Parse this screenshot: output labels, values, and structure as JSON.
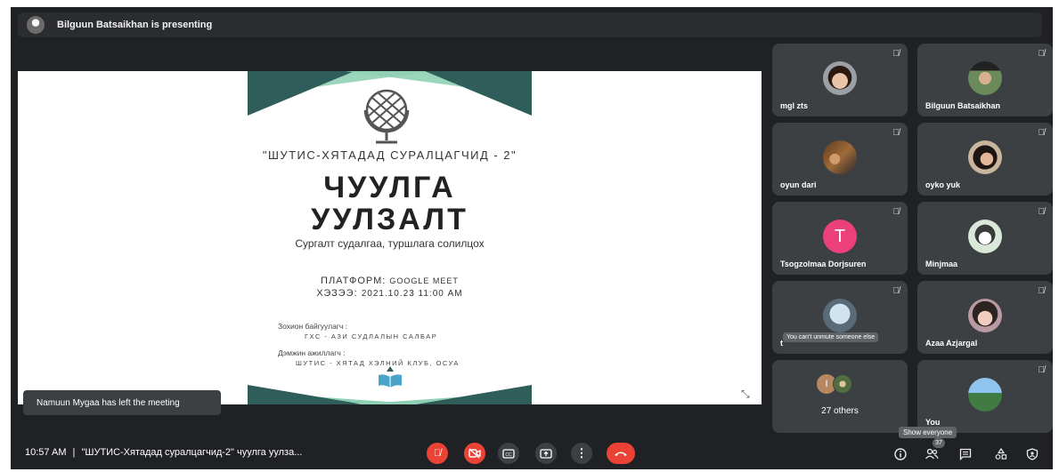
{
  "presenter": {
    "text": "Bilguun Batsaikhan is presenting"
  },
  "slide": {
    "subtitle_top": "\"ШУТИС-ХЯТАДАД СУРАЛЦАГЧИД - 2\"",
    "title_line1": "ЧУУЛГА",
    "title_line2": "УУЛЗАЛТ",
    "tagline": "Сургалт судалгаа, туршлага солилцох",
    "platform_label": "ПЛАТФОРМ:",
    "platform_value": "GOOGLE MEET",
    "date_label": "ХЭЗЭЭ:",
    "date_value": "2021.10.23  11:00 AM",
    "organizer_label": "Зохион байгуулагч :",
    "organizer_value": "ГХС - АЗИ СУДЛАЛЫН САЛБАР",
    "supporter_label": "Дэмжин ажиллагч :",
    "supporter_value": "ШУТИС - ХЯТАД ХЭЛНИЙ КЛУБ, ОСУА",
    "colors": {
      "dark_green": "#2f5d5a",
      "light_green": "#8fd0b5"
    }
  },
  "participants": [
    {
      "name": "mgl zts",
      "muted": true,
      "avatar": "photo"
    },
    {
      "name": "Bilguun Batsaikhan",
      "muted": true,
      "avatar": "photo"
    },
    {
      "name": "oyun dari",
      "muted": true,
      "avatar": "photo"
    },
    {
      "name": "oyko yuk",
      "muted": true,
      "avatar": "photo"
    },
    {
      "name": "Tsogzolmaa Dorjsuren",
      "muted": true,
      "avatar": "initial",
      "initial": "T"
    },
    {
      "name": "Minjmaa",
      "muted": true,
      "avatar": "photo"
    },
    {
      "name": "t",
      "muted": true,
      "avatar": "photo",
      "tooltip": "You can't unmute someone else"
    },
    {
      "name": "Azaa Azjargal",
      "muted": true,
      "avatar": "photo"
    },
    {
      "name": "27 others",
      "muted": false,
      "avatar": "group",
      "initial": "I"
    },
    {
      "name": "You",
      "muted": true,
      "avatar": "photo"
    }
  ],
  "toast": {
    "text": "Namuun Mygaa has left the meeting"
  },
  "bottom": {
    "time": "10:57 AM",
    "separator": "|",
    "meeting_title": "\"ШУТИС-Хятадад суралцагчид-2\" чуулга уулза...",
    "participant_count": "37",
    "show_everyone_tooltip": "Show everyone"
  },
  "icons": [
    "mic-off-icon",
    "camera-off-icon",
    "captions-icon",
    "present-icon",
    "more-options-icon",
    "hang-up-icon",
    "info-icon",
    "people-icon",
    "chat-icon",
    "activities-icon",
    "host-controls-icon"
  ],
  "theme": {
    "background": "#202124",
    "tile": "#3c4043",
    "danger": "#ea4335",
    "accent_pink": "#ec407a"
  }
}
